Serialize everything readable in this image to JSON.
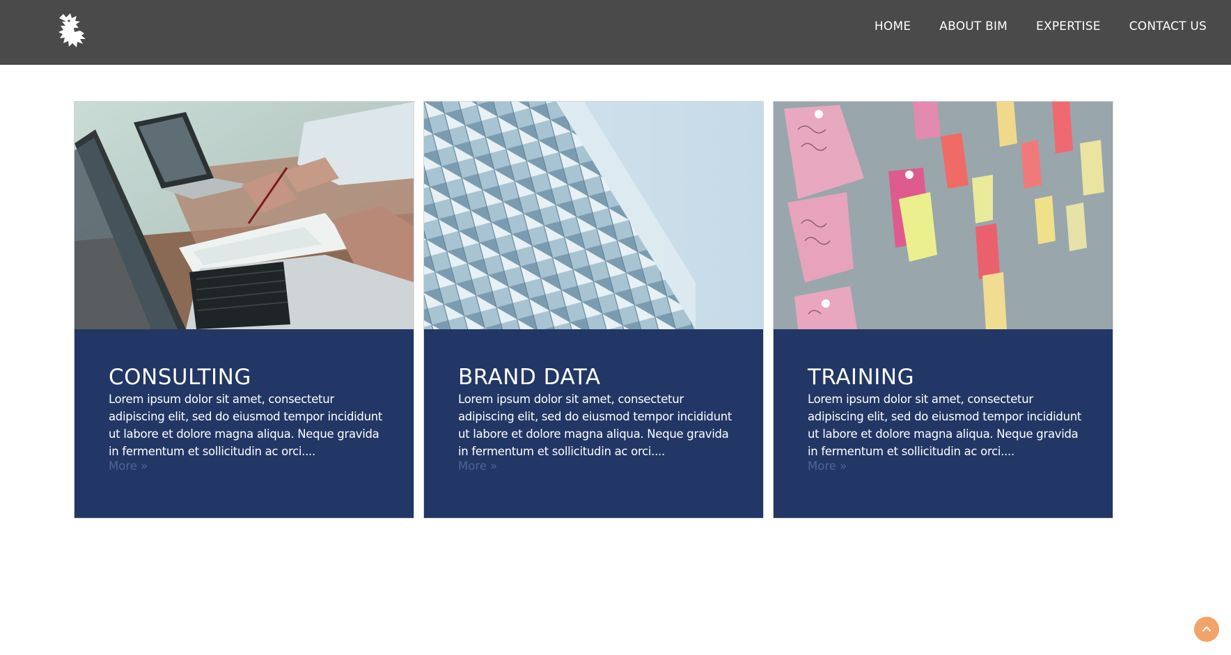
{
  "nav": {
    "items": [
      {
        "label": "HOME"
      },
      {
        "label": "ABOUT BIM"
      },
      {
        "label": "EXPERTISE"
      },
      {
        "label": "CONTACT US"
      }
    ]
  },
  "logo": {
    "icon": "griffin-logo-icon"
  },
  "cards": [
    {
      "title": "CONSULTING",
      "text": "Lorem ipsum dolor sit amet, consectetur adipiscing elit, sed do eiusmod tempor incididunt ut labore et dolore magna aliqua. Neque gravida in fermentum et sollicitudin ac orci....",
      "more": "More »",
      "image": "laptops-meeting-photo"
    },
    {
      "title": "BRAND DATA",
      "text": "Lorem ipsum dolor sit amet, consectetur adipiscing elit, sed do eiusmod tempor incididunt ut labore et dolore magna aliqua. Neque gravida in fermentum et sollicitudin ac orci....",
      "more": "More »",
      "image": "glass-building-photo"
    },
    {
      "title": "TRAINING",
      "text": "Lorem ipsum dolor sit amet, consectetur adipiscing elit, sed do eiusmod tempor incididunt ut labore et dolore magna aliqua. Neque gravida in fermentum et sollicitudin ac orci....",
      "more": "More »",
      "image": "sticky-notes-wall-photo"
    }
  ],
  "scroll_top": {
    "icon": "chevron-up-icon"
  },
  "colors": {
    "header_bg": "#4a4a4a",
    "card_bg": "#223765",
    "more_link": "#4f6592",
    "scroll_top_bg": "#f2a36a"
  }
}
